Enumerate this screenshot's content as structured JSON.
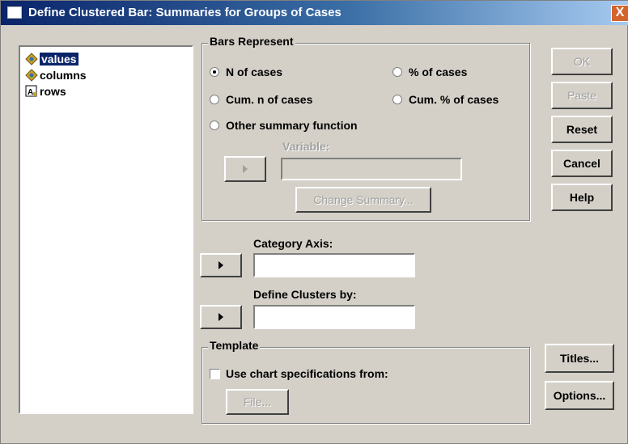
{
  "window": {
    "title": "Define Clustered Bar: Summaries for Groups of Cases",
    "close_glyph": "X"
  },
  "variables": [
    {
      "label": "values",
      "icon": "scale-variable-icon",
      "selected": true
    },
    {
      "label": "columns",
      "icon": "scale-variable-icon",
      "selected": false
    },
    {
      "label": "rows",
      "icon": "nominal-variable-icon",
      "selected": false
    }
  ],
  "bars_represent": {
    "legend": "Bars Represent",
    "options": [
      {
        "label": "N of cases",
        "checked": true
      },
      {
        "label": "% of cases",
        "checked": false
      },
      {
        "label": "Cum. n of cases",
        "checked": false
      },
      {
        "label": "Cum. % of cases",
        "checked": false
      },
      {
        "label": "Other summary function",
        "checked": false
      }
    ],
    "variable_label": "Variable:",
    "variable_value": "",
    "change_summary_label": "Change Summary..."
  },
  "category_axis": {
    "label": "Category Axis:",
    "value": ""
  },
  "define_clusters": {
    "label": "Define Clusters by:",
    "value": ""
  },
  "template": {
    "legend": "Template",
    "checkbox_label": "Use chart specifications from:",
    "checked": false,
    "file_button": "File..."
  },
  "buttons": {
    "ok": "OK",
    "paste": "Paste",
    "reset": "Reset",
    "cancel": "Cancel",
    "help": "Help",
    "titles": "Titles...",
    "options": "Options..."
  }
}
